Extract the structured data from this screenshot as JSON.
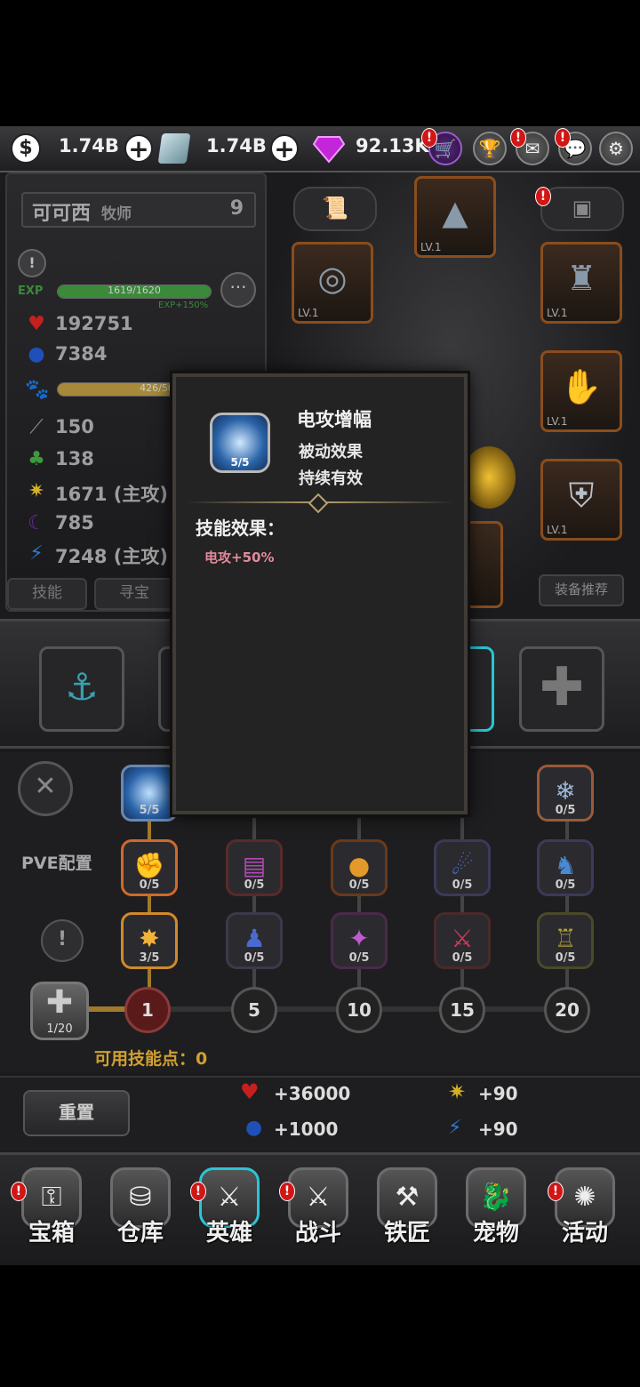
{
  "topbar": {
    "gold": "1.74B",
    "crystal": "1.74B",
    "gems": "92.13K"
  },
  "hero": {
    "name": "可可西",
    "class": "牧师",
    "level": "9",
    "exp_label": "EXP",
    "exp_text": "1619/1620",
    "exp_fill": 0.999,
    "exp_bonus": "EXP+150%",
    "pet_text": "426/500",
    "pet_fill": 0.852,
    "hp": "192751",
    "mp": "7384",
    "atk": "150",
    "def": "138",
    "stat_a": "1671 (主攻)",
    "stat_b": "785",
    "stat_c": "7248 (主攻)"
  },
  "left_tabs": {
    "skill": "技能",
    "treasure": "寻宝"
  },
  "equip": {
    "recommend": "装备推荐",
    "slot_level": "LV.1"
  },
  "tree": {
    "pve_label": "PVE配置",
    "skill_points_label": "可用技能点：0",
    "slot_counter": "1/20",
    "row1": [
      "5/5",
      "0/5"
    ],
    "row2": [
      "0/5",
      "0/5",
      "0/5",
      "0/5",
      "0/5"
    ],
    "row3": [
      "3/5",
      "0/5",
      "0/5",
      "0/5",
      "0/5"
    ],
    "levels": [
      "1",
      "5",
      "10",
      "15",
      "20"
    ]
  },
  "bonuses": {
    "reset": "重置",
    "hp": "+36000",
    "mp": "+1000",
    "stat_a": "+90",
    "stat_c": "+90"
  },
  "nav": {
    "items": [
      "宝箱",
      "仓库",
      "英雄",
      "战斗",
      "铁匠",
      "宠物",
      "活动"
    ]
  },
  "popup": {
    "title": "电攻增幅",
    "level": "5/5",
    "type": "被动效果",
    "duration": "持续有效",
    "effect_header": "技能效果：",
    "effect": "电攻+50%"
  },
  "colors": {
    "accent_cyan": "#29c6d6",
    "alert_red": "#d21515",
    "exp_green": "#3a8a3a",
    "pet_gold": "#a68a3a",
    "effect_pink": "#e18a9a"
  }
}
